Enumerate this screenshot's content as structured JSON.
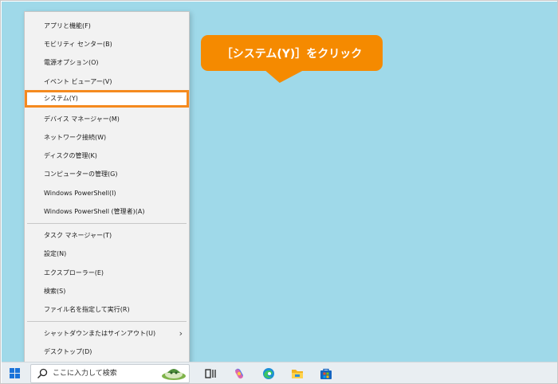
{
  "menu": {
    "items": [
      {
        "label": "アプリと機能(F)"
      },
      {
        "label": "モビリティ センター(B)"
      },
      {
        "label": "電源オプション(O)"
      },
      {
        "label": "イベント ビューアー(V)"
      },
      {
        "label": "システム(Y)",
        "highlighted": true
      },
      {
        "label": "デバイス マネージャー(M)"
      },
      {
        "label": "ネットワーク接続(W)"
      },
      {
        "label": "ディスクの管理(K)"
      },
      {
        "label": "コンピューターの管理(G)"
      },
      {
        "label": "Windows PowerShell(I)"
      },
      {
        "label": "Windows PowerShell (管理者)(A)"
      },
      {
        "label": "タスク マネージャー(T)"
      },
      {
        "label": "設定(N)"
      },
      {
        "label": "エクスプローラー(E)"
      },
      {
        "label": "検索(S)"
      },
      {
        "label": "ファイル名を指定して実行(R)"
      },
      {
        "label": "シャットダウンまたはサインアウト(U)",
        "has_submenu": true
      },
      {
        "label": "デスクトップ(D)"
      }
    ]
  },
  "callout": {
    "text": "［システム(Y)］をクリック"
  },
  "taskbar": {
    "start_icon": "windows-logo-icon",
    "search": {
      "placeholder": "ここに入力して検索",
      "icon": "search-icon"
    },
    "icons": [
      "task-view-icon",
      "copilot-icon",
      "edge-icon",
      "file-explorer-icon",
      "store-icon"
    ]
  },
  "colors": {
    "desktop": "#9fd9e9",
    "accent_orange": "#f58a1f",
    "callout": "#f58a00",
    "taskbar": "#e9eef2"
  }
}
